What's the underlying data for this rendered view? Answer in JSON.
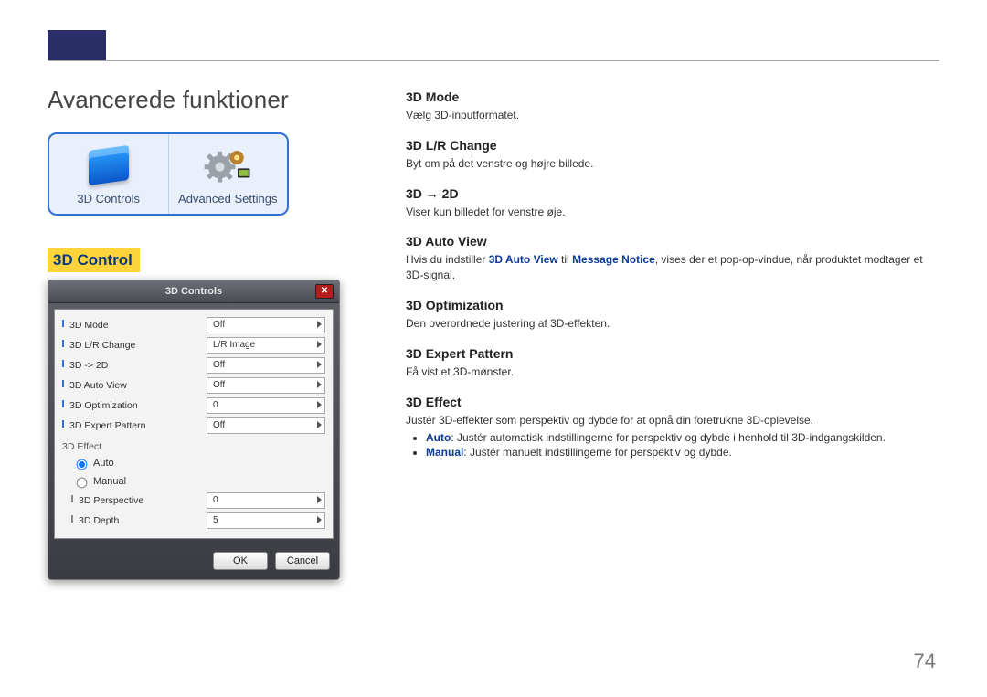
{
  "page_number": "74",
  "chapter_title": "Avancerede funktioner",
  "left": {
    "tiles": [
      {
        "label": "3D Controls",
        "icon": "cube-icon"
      },
      {
        "label": "Advanced Settings",
        "icon": "gears-icon"
      }
    ],
    "section_heading": "3D Control",
    "dialog": {
      "title": "3D Controls",
      "rows": [
        {
          "label": "3D Mode",
          "value": "Off"
        },
        {
          "label": "3D L/R Change",
          "value": "L/R Image"
        },
        {
          "label": "3D -> 2D",
          "value": "Off"
        },
        {
          "label": "3D Auto View",
          "value": "Off"
        },
        {
          "label": "3D Optimization",
          "value": "0"
        },
        {
          "label": "3D Expert Pattern",
          "value": "Off"
        }
      ],
      "effect_group": {
        "title": "3D Effect",
        "radios": [
          {
            "label": "Auto",
            "value": "auto",
            "checked": true
          },
          {
            "label": "Manual",
            "value": "manual",
            "checked": false
          }
        ],
        "subrows": [
          {
            "label": "3D Perspective",
            "value": "0"
          },
          {
            "label": "3D Depth",
            "value": "5"
          }
        ]
      },
      "buttons": {
        "ok": "OK",
        "cancel": "Cancel"
      }
    }
  },
  "right": {
    "s1": {
      "h": "3D Mode",
      "p": "Vælg 3D-inputformatet."
    },
    "s2": {
      "h": "3D L/R Change",
      "p": "Byt om på det venstre og højre billede."
    },
    "s3": {
      "h": "3D → 2D",
      "p": "Viser kun billedet for venstre øje."
    },
    "s4": {
      "h": "3D Auto View",
      "p_pre": "Hvis du indstiller ",
      "p_link1": "3D Auto View",
      "p_mid": " til ",
      "p_link2": "Message Notice",
      "p_post": ", vises der et pop-op-vindue, når produktet modtager et 3D-signal."
    },
    "s5": {
      "h": "3D Optimization",
      "p": "Den overordnede justering af 3D-effekten."
    },
    "s6": {
      "h": "3D Expert Pattern",
      "p": "Få vist et 3D-mønster."
    },
    "s7": {
      "h": "3D Effect",
      "p": "Justér 3D-effekter som perspektiv og dybde for at opnå din foretrukne 3D-oplevelse.",
      "bullets": [
        {
          "term": "Auto",
          "text": ": Justér automatisk indstillingerne for perspektiv og dybde i henhold til 3D-indgangskilden."
        },
        {
          "term": "Manual",
          "text": ": Justér manuelt indstillingerne for perspektiv og dybde."
        }
      ]
    }
  }
}
